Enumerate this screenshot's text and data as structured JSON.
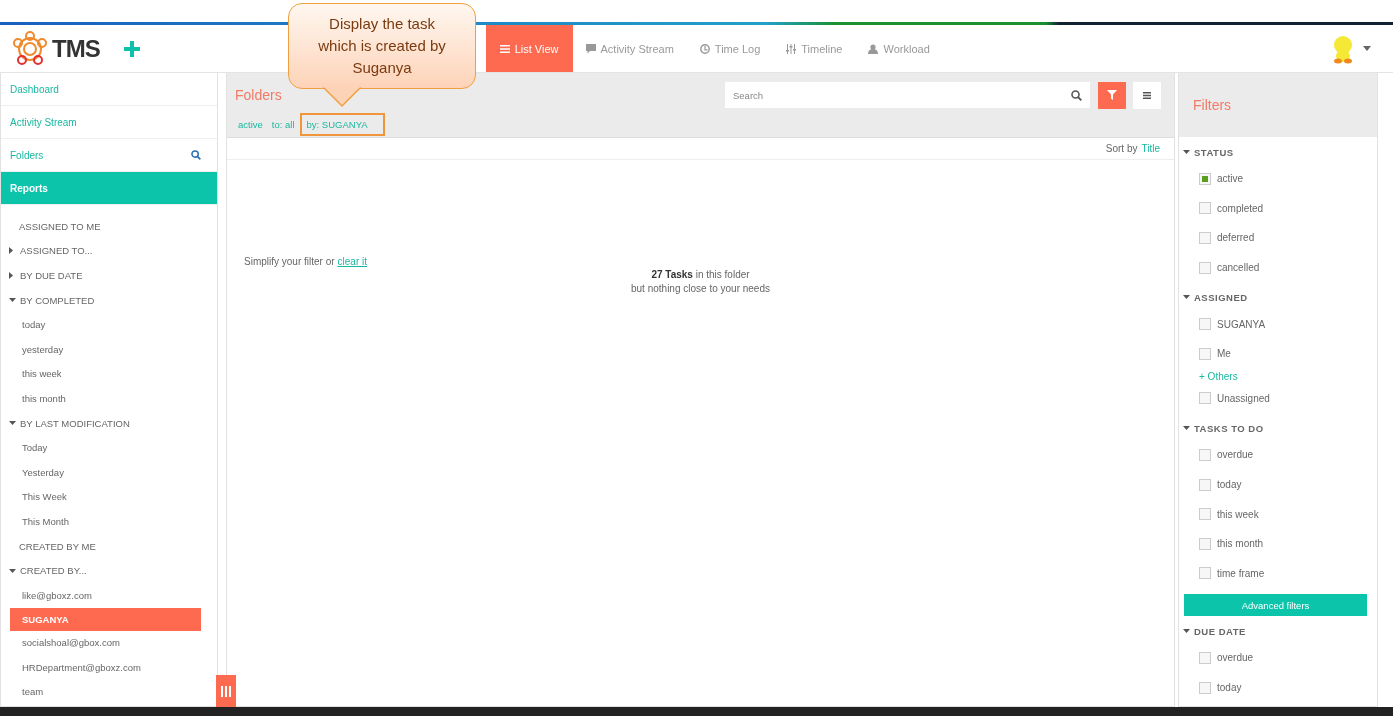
{
  "header": {
    "logo": "TMS",
    "tabs": [
      {
        "label": "List View",
        "selected": true
      },
      {
        "label": "Activity Stream",
        "selected": false
      },
      {
        "label": "Time Log",
        "selected": false
      },
      {
        "label": "Timeline",
        "selected": false
      },
      {
        "label": "Workload",
        "selected": false
      }
    ]
  },
  "callout": {
    "text": "Display the task which is created by Suganya"
  },
  "sidebar": {
    "nav": [
      {
        "label": "Dashboard",
        "selected": false,
        "search": false
      },
      {
        "label": "Activity Stream",
        "selected": false,
        "search": false
      },
      {
        "label": "Folders",
        "selected": false,
        "search": true
      },
      {
        "label": "Reports",
        "selected": true,
        "search": false
      }
    ],
    "tree": [
      {
        "label": "ASSIGNED TO ME",
        "selected": false
      },
      {
        "label": "ASSIGNED TO...",
        "expanded": false,
        "selected": false
      },
      {
        "label": "BY DUE DATE",
        "expanded": false,
        "selected": false
      },
      {
        "label": "BY COMPLETED",
        "expanded": true,
        "selected": false,
        "children": [
          {
            "label": "today",
            "selected": false
          },
          {
            "label": "yesterday",
            "selected": false
          },
          {
            "label": "this week",
            "selected": false
          },
          {
            "label": "this month",
            "selected": false
          }
        ]
      },
      {
        "label": "BY LAST MODIFICATION",
        "expanded": true,
        "selected": false,
        "children": [
          {
            "label": "Today",
            "selected": false
          },
          {
            "label": "Yesterday",
            "selected": false
          },
          {
            "label": "This Week",
            "selected": false
          },
          {
            "label": "This Month",
            "selected": false
          }
        ]
      },
      {
        "label": "CREATED BY ME",
        "selected": false
      },
      {
        "label": "CREATED BY...",
        "expanded": true,
        "selected": false,
        "children": [
          {
            "label": "like@gboxz.com",
            "selected": false
          },
          {
            "label": "SUGANYA",
            "selected": true
          },
          {
            "label": "socialshoal@gbox.com",
            "selected": false
          },
          {
            "label": "HRDepartment@gboxz.com",
            "selected": false
          },
          {
            "label": "team",
            "selected": false
          }
        ]
      }
    ]
  },
  "main": {
    "title": "Folders",
    "search": {
      "placeholder": "Search"
    },
    "chips": [
      {
        "label": "active",
        "highlighted": false
      },
      {
        "label": "to: all",
        "highlighted": false
      },
      {
        "label": "by: SUGANYA",
        "highlighted": true
      }
    ],
    "sort_label": "Sort by",
    "sort_value": "Title",
    "hint": "Simplify your filter or",
    "hint_link": "clear it",
    "count": "**27 Tasks** in this folder",
    "note": "but nothing close to your needs"
  },
  "filters": {
    "title": "Filters",
    "sections": [
      {
        "title": "STATUS",
        "expanded": true,
        "options": [
          {
            "kind": "checkbox",
            "label": "active",
            "checked": true
          },
          {
            "kind": "checkbox",
            "label": "completed",
            "checked": false
          },
          {
            "kind": "checkbox",
            "label": "deferred",
            "checked": false
          },
          {
            "kind": "checkbox",
            "label": "cancelled",
            "checked": false
          }
        ]
      },
      {
        "title": "ASSIGNED",
        "expanded": true,
        "options": [
          {
            "kind": "checkbox",
            "label": "SUGANYA",
            "checked": false
          },
          {
            "kind": "checkbox",
            "label": "Me",
            "checked": false
          },
          {
            "kind": "link",
            "label": "+ Others"
          },
          {
            "kind": "checkbox",
            "label": "Unassigned",
            "checked": false
          }
        ]
      },
      {
        "title": "TASKS TO DO",
        "expanded": true,
        "options": [
          {
            "kind": "checkbox",
            "label": "overdue",
            "checked": false
          },
          {
            "kind": "checkbox",
            "label": "today",
            "checked": false
          },
          {
            "kind": "checkbox",
            "label": "this week",
            "checked": false
          },
          {
            "kind": "checkbox",
            "label": "this month",
            "checked": false
          },
          {
            "kind": "checkbox",
            "label": "time frame",
            "checked": false
          },
          {
            "kind": "button",
            "label": "Advanced filters"
          }
        ]
      },
      {
        "title": "DUE DATE",
        "expanded": true,
        "options": [
          {
            "kind": "checkbox",
            "label": "overdue",
            "checked": false
          },
          {
            "kind": "checkbox",
            "label": "today",
            "checked": false
          }
        ]
      }
    ]
  }
}
